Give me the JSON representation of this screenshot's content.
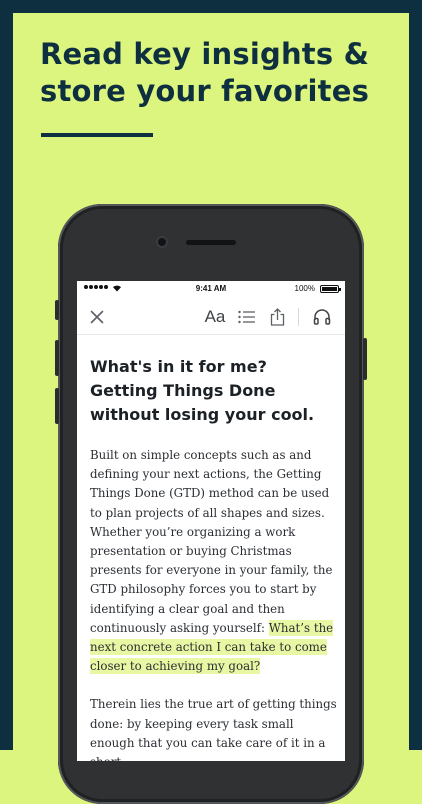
{
  "promo": {
    "headline_line1": "Read key insights &",
    "headline_line2": "store your favorites"
  },
  "status_bar": {
    "time": "9:41 AM",
    "battery_percent": "100%",
    "signal_icon": "signal-dots-icon",
    "wifi_icon": "wifi-icon"
  },
  "toolbar": {
    "close_icon": "close-icon",
    "font_size_label": "Aa",
    "contents_icon": "list-icon",
    "share_icon": "share-icon",
    "audio_icon": "headphones-icon"
  },
  "article": {
    "title": "What's in it for me? Getting Things Done without losing your cool.",
    "paragraph1_text": "Built on simple concepts such as and defining your next actions, the Getting Things Done (GTD) method can be used to plan projects of all shapes and sizes. Whether you’re organizing a work presentation or buying Christmas presents for everyone in your family, the GTD philosophy forces you to start by identifying a clear goal and then continuously asking yourself: ",
    "paragraph1_highlight": "What’s the next concrete action I can take to come closer to achieving my goal?",
    "paragraph2": "Therein lies the true art of getting things done: by keeping every task small enough that you can take care of it in a short"
  },
  "colors": {
    "background": "#dcf57e",
    "frame": "#0e2f3f",
    "highlight": "#e7f7a3"
  }
}
